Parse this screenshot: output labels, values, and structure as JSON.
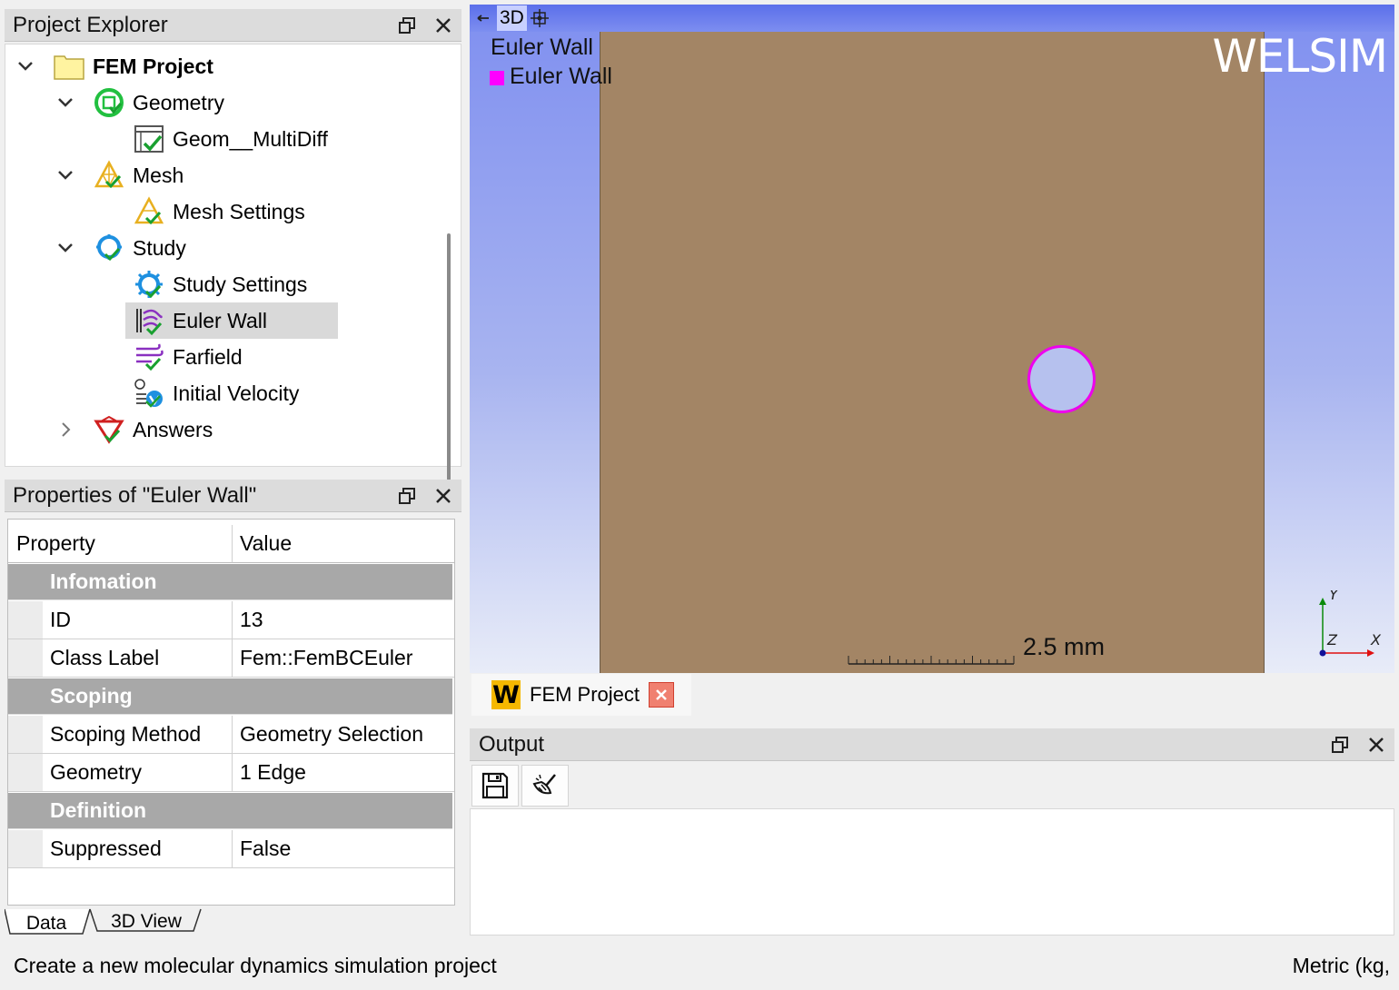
{
  "explorer": {
    "title": "Project Explorer",
    "items": [
      {
        "label": "FEM Project"
      },
      {
        "label": "Geometry"
      },
      {
        "label": "Geom__MultiDiff"
      },
      {
        "label": "Mesh"
      },
      {
        "label": "Mesh Settings"
      },
      {
        "label": "Study"
      },
      {
        "label": "Study Settings"
      },
      {
        "label": "Euler Wall"
      },
      {
        "label": "Farfield"
      },
      {
        "label": "Initial Velocity"
      },
      {
        "label": "Answers"
      }
    ]
  },
  "properties": {
    "title": "Properties of \"Euler Wall\"",
    "header": {
      "property": "Property",
      "value": "Value"
    },
    "groups": [
      {
        "name": "Infomation",
        "rows": [
          {
            "property": "ID",
            "value": "13"
          },
          {
            "property": "Class Label",
            "value": "Fem::FemBCEuler"
          }
        ]
      },
      {
        "name": "Scoping",
        "rows": [
          {
            "property": "Scoping Method",
            "value": "Geometry Selection"
          },
          {
            "property": "Geometry",
            "value": "1 Edge"
          }
        ]
      },
      {
        "name": "Definition",
        "rows": [
          {
            "property": "Suppressed",
            "value": "False"
          }
        ]
      }
    ]
  },
  "bottom_tabs": [
    {
      "label": "Data"
    },
    {
      "label": "3D View"
    }
  ],
  "viewport": {
    "toolbar_mode": "3D",
    "title_label": "Euler Wall",
    "legend_label": "Euler Wall",
    "legend_color": "#ff00ff",
    "logo": "WELSIM",
    "scale_label": "2.5 mm",
    "axes": {
      "y": "Y",
      "z": "Z",
      "x": "X"
    }
  },
  "document_tab": {
    "logo_letter": "W",
    "label": "FEM Project"
  },
  "output": {
    "title": "Output"
  },
  "status": {
    "left": "Create a new molecular dynamics simulation project",
    "right": "Metric (kg,"
  }
}
